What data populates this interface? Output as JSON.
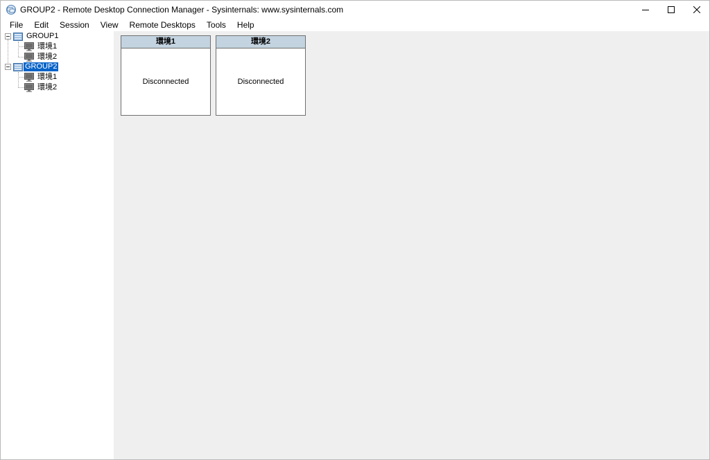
{
  "window": {
    "title": "GROUP2 - Remote Desktop Connection Manager - Sysinternals: www.sysinternals.com"
  },
  "menu": [
    "File",
    "Edit",
    "Session",
    "View",
    "Remote Desktops",
    "Tools",
    "Help"
  ],
  "tree": {
    "groups": [
      {
        "label": "GROUP1",
        "selected": false,
        "servers": [
          "環境1",
          "環境2"
        ]
      },
      {
        "label": "GROUP2",
        "selected": true,
        "servers": [
          "環境1",
          "環境2"
        ]
      }
    ]
  },
  "thumbnails": [
    {
      "title": "環境1",
      "status": "Disconnected"
    },
    {
      "title": "環境2",
      "status": "Disconnected"
    }
  ],
  "colors": {
    "selection": "#0a64c8",
    "thumbnail_header": "#c3d3e0",
    "main_background": "#efefef"
  },
  "icons": {
    "app": "remote-desktop-app-icon",
    "group": "server-group-icon",
    "server": "monitor-icon",
    "expander": "tree-collapse-icon"
  }
}
